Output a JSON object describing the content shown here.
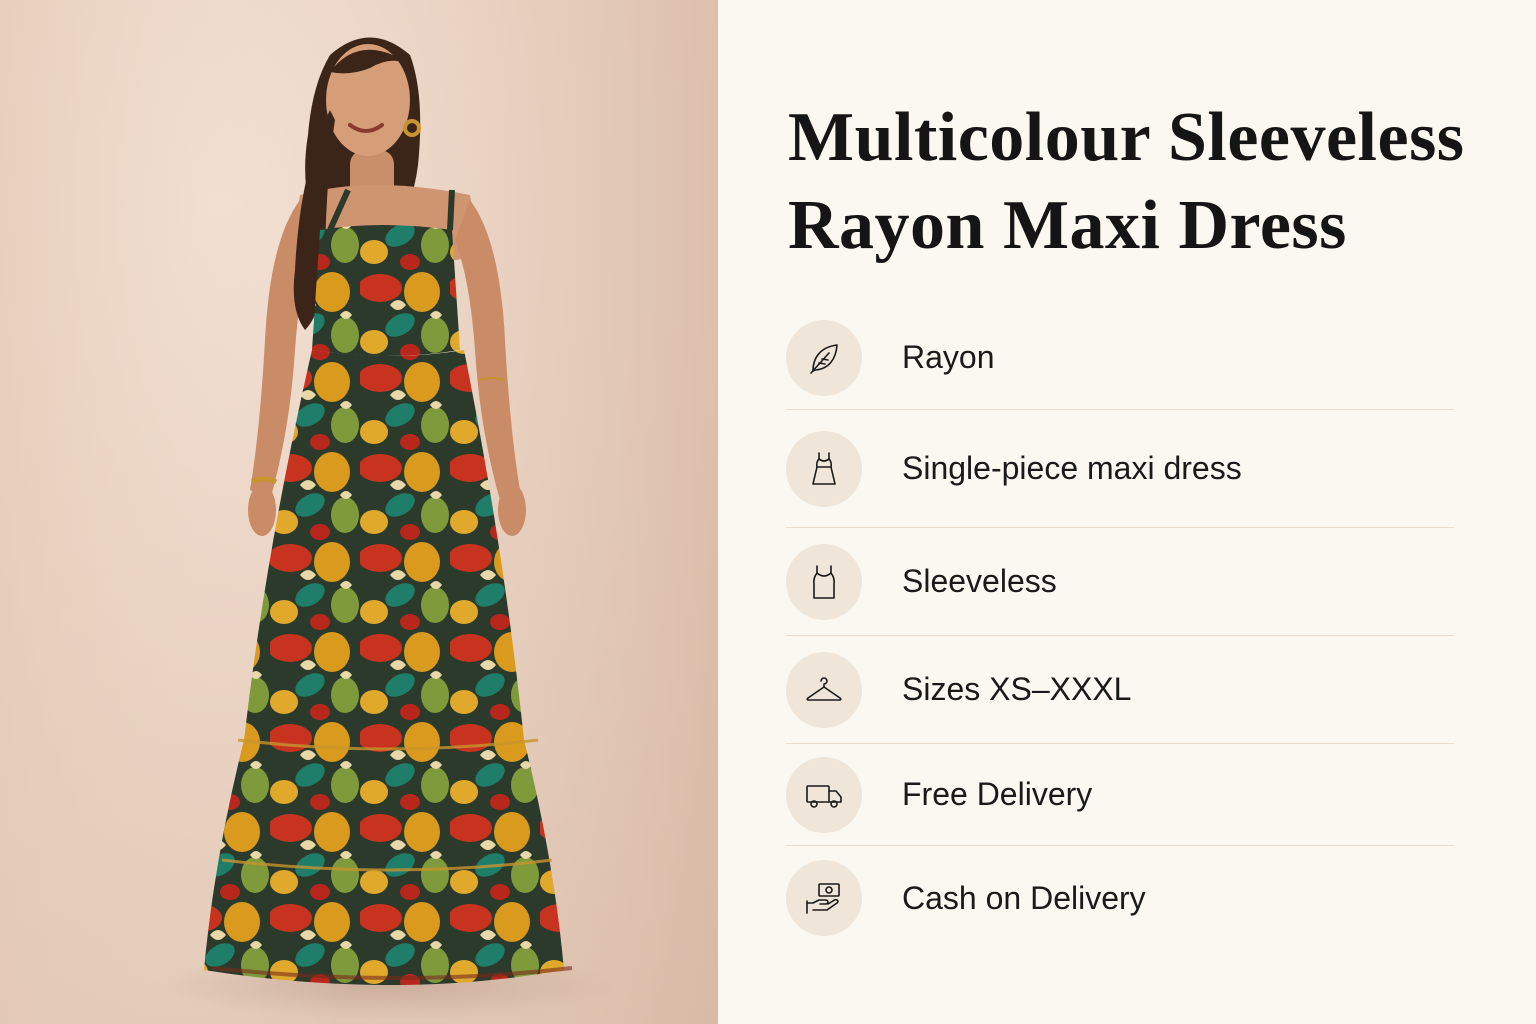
{
  "title": {
    "line1": "Multicolour Sleeveless",
    "line2": "Rayon Maxi Dress"
  },
  "features": [
    {
      "label": "Rayon",
      "icon": "leaf-icon"
    },
    {
      "label": "Single-piece maxi dress",
      "icon": "dress-icon"
    },
    {
      "label": "Sleeveless",
      "icon": "tank-top-icon"
    },
    {
      "label": "Sizes XS–XXXL",
      "icon": "hanger-icon"
    },
    {
      "label": "Free Delivery",
      "icon": "truck-icon"
    },
    {
      "label": "Cash on Delivery",
      "icon": "cash-in-hand-icon"
    }
  ],
  "colors": {
    "panel_background": "#fbf7f1",
    "icon_circle": "#efe5d8",
    "divider": "#e9ddd0",
    "text": "#151515",
    "photo_background": "#e9d2c2"
  }
}
